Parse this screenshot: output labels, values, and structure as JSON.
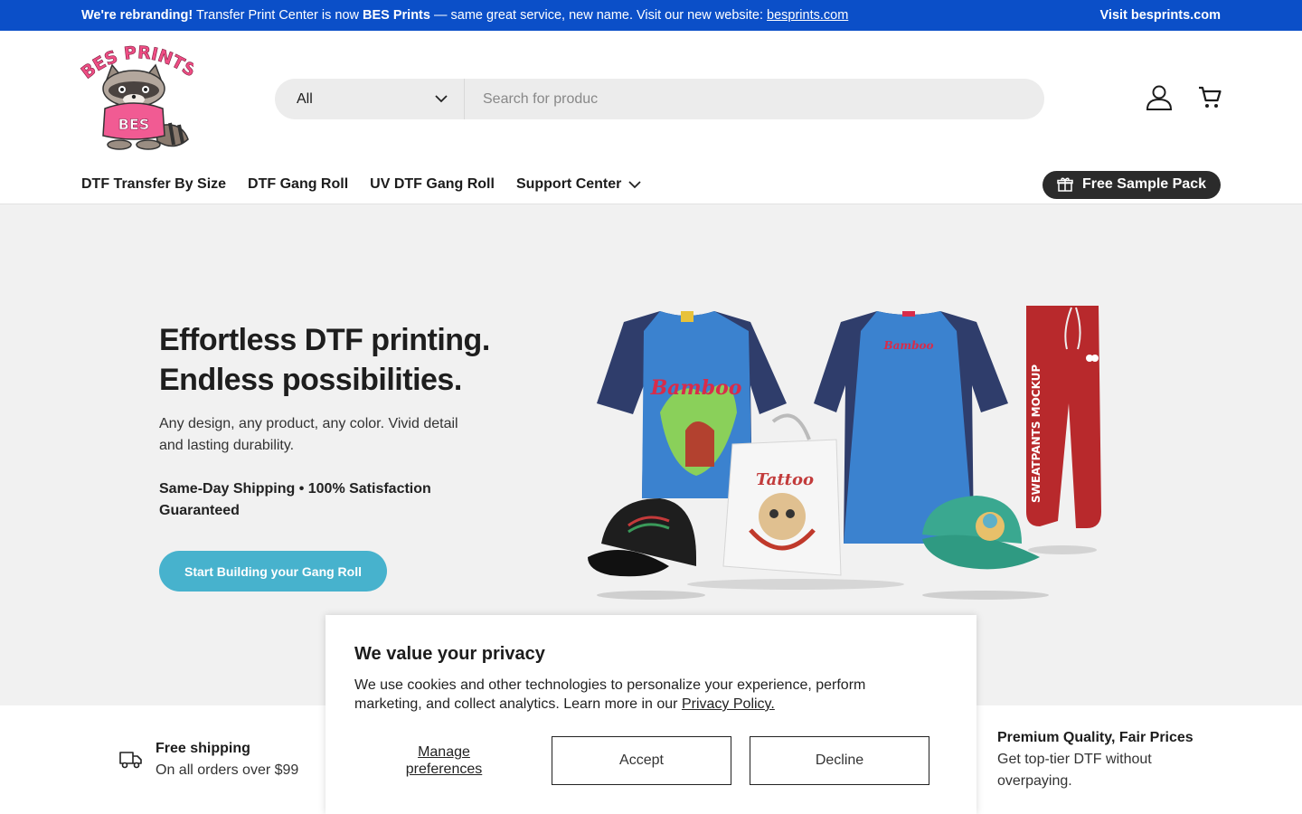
{
  "announcement": {
    "lead": "We're rebranding!",
    "text1": "Transfer Print Center is now",
    "brand": "BES Prints",
    "text2": "— same great service, new name. Visit our new website:",
    "link": "besprints.com",
    "visit": "Visit besprints.com"
  },
  "logo": {
    "top_text": "BES PRINTS",
    "shirt_text": "BES"
  },
  "search": {
    "category": "All",
    "placeholder": "Search for produc"
  },
  "nav": {
    "items": [
      "DTF Transfer By Size",
      "DTF Gang Roll",
      "UV DTF Gang Roll",
      "Support Center"
    ],
    "sample": "Free Sample Pack"
  },
  "hero": {
    "title_line1": "Effortless DTF printing.",
    "title_line2": "Endless possibilities.",
    "subtitle": "Any design, any product, any color. Vivid detail and lasting durability.",
    "perks": "Same-Day Shipping • 100% Satisfaction Guaranteed",
    "cta": "Start Building your Gang Roll",
    "art": {
      "shirt_text": "Bamboo",
      "bag_text": "Tattoo",
      "pants_text": "SWEATPANTS MOCKUP"
    }
  },
  "features": [
    {
      "title": "Free shipping",
      "desc": "On all orders over $99"
    },
    {
      "title": "Premium Quality, Fair Prices",
      "desc": "Get top-tier DTF without overpaying."
    }
  ],
  "cookie": {
    "title": "We value your privacy",
    "text": "We use cookies and other technologies to personalize your experience, perform marketing, and collect analytics. Learn more in our",
    "link": "Privacy Policy.",
    "manage": "Manage preferences",
    "accept": "Accept",
    "decline": "Decline"
  },
  "colors": {
    "announcement_bg": "#0b4fc8",
    "cta_bg": "#47b2cd",
    "sample_bg": "#2b2b2b",
    "hero_bg": "#f1f1f1"
  }
}
